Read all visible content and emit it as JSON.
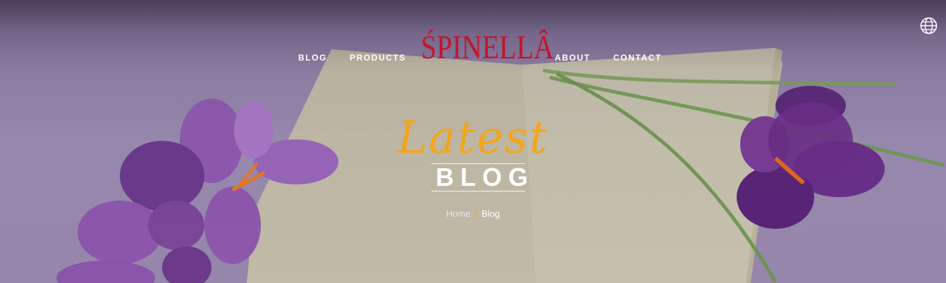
{
  "nav": {
    "items": [
      {
        "label": "BLOG"
      },
      {
        "label": "PRODUCTS"
      },
      {
        "label": "ABOUT"
      },
      {
        "label": "CONTACT"
      }
    ],
    "logo_text": "ŚPINELLÂ",
    "language_icon": "globe-icon"
  },
  "hero": {
    "script_title": "Latest",
    "title": "BLOG",
    "breadcrumb": {
      "home": "Home",
      "separator": "/",
      "current": "Blog"
    }
  },
  "colors": {
    "accent": "#f2a51f",
    "logo": "#c0162a",
    "text": "#ffffff"
  }
}
